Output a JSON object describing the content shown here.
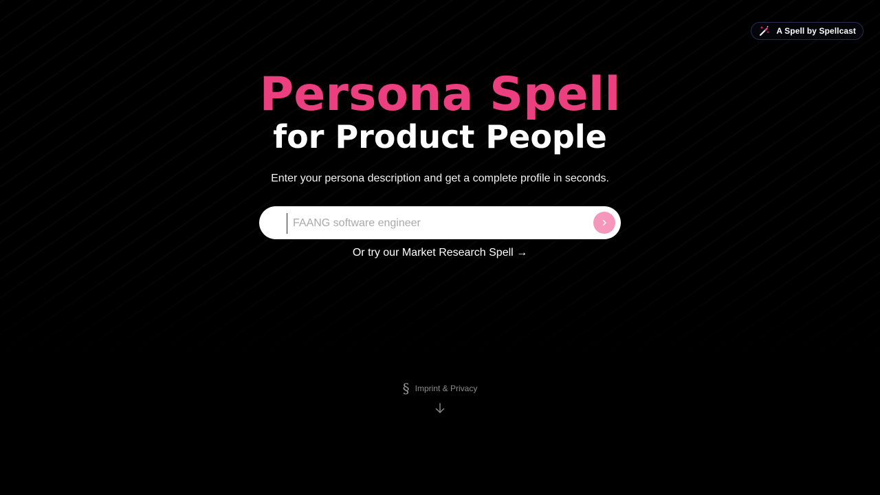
{
  "badge": {
    "label": "A Spell by Spellcast",
    "icon": "magic-wand-icon"
  },
  "hero": {
    "title": "Persona Spell",
    "subtitle": "for Product People",
    "description": "Enter your persona description and get a complete profile in seconds."
  },
  "search": {
    "value": "",
    "placeholder": "FAANG software engineer",
    "submit_icon": "chevron-right-icon"
  },
  "alt_link": {
    "text": "Or try our Market Research Spell",
    "arrow": "→"
  },
  "footer": {
    "icon_glyph": "§",
    "link_label": "Imprint & Privacy",
    "scroll_icon": "arrow-down-icon"
  },
  "colors": {
    "accent_pink": "#ec3f7f",
    "button_pink": "#f597ba",
    "background": "#000000"
  }
}
